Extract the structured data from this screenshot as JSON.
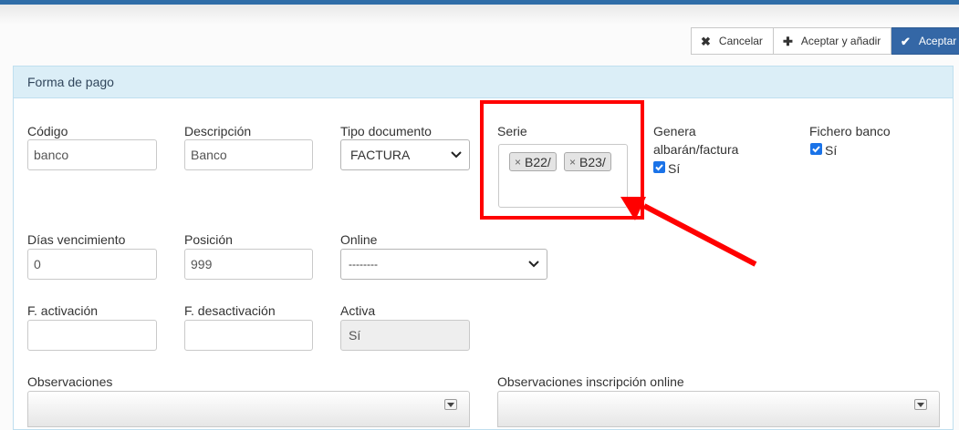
{
  "toolbar": {
    "cancel_label": "Cancelar",
    "save_add_label": "Aceptar y añadir",
    "save_label": "Aceptar"
  },
  "panel": {
    "title": "Forma de pago"
  },
  "form": {
    "codigo": {
      "label": "Código",
      "value": "banco"
    },
    "descripcion": {
      "label": "Descripción",
      "value": "Banco"
    },
    "tipo_documento": {
      "label": "Tipo documento",
      "value": "FACTURA"
    },
    "serie": {
      "label": "Serie",
      "tags": [
        "B22/",
        "B23/"
      ]
    },
    "genera": {
      "label_line1": "Genera",
      "label_line2": "albarán/factura",
      "checked": true,
      "checkbox_label": "Sí"
    },
    "fichero_banco": {
      "label": "Fichero banco",
      "checked": true,
      "checkbox_label": "Sí"
    },
    "dias_vencimiento": {
      "label": "Días vencimiento",
      "value": "0"
    },
    "posicion": {
      "label": "Posición",
      "value": "999"
    },
    "online": {
      "label": "Online",
      "value": "--------"
    },
    "f_activacion": {
      "label": "F. activación",
      "value": ""
    },
    "f_desactivacion": {
      "label": "F. desactivación",
      "value": ""
    },
    "activa": {
      "label": "Activa",
      "value": "Sí"
    },
    "observaciones": {
      "label": "Observaciones"
    },
    "observaciones_online": {
      "label": "Observaciones inscripción online"
    }
  },
  "annotation": {
    "color": "#ff0000"
  }
}
